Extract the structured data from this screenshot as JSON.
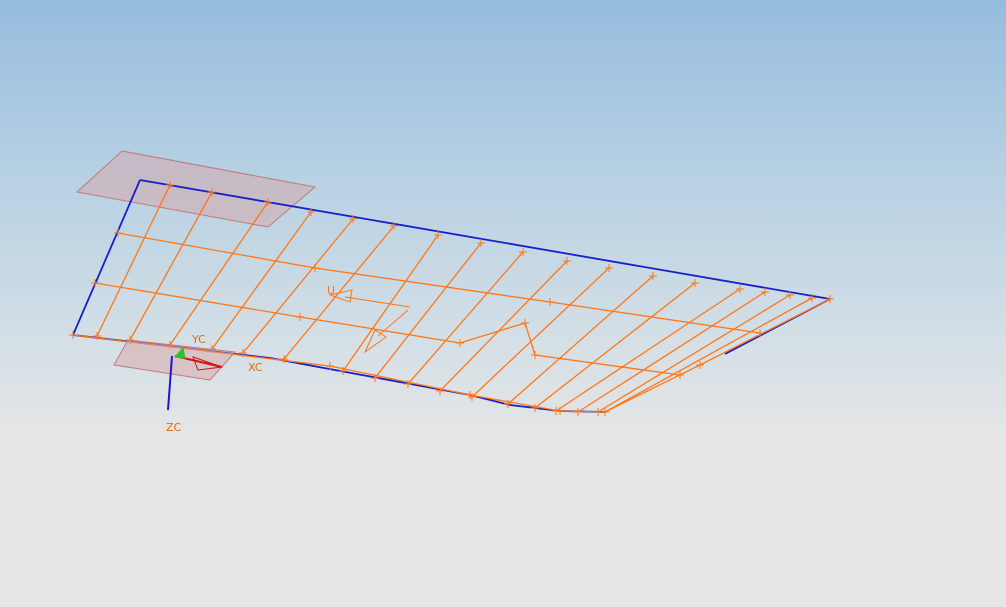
{
  "viewport": {
    "background_top": "#96bcdd",
    "background_bottom": "#e6e6e6"
  },
  "colors": {
    "grid_line": "#ff7716",
    "boundary": "#1420c8",
    "plane_fill": "#d9a0a0",
    "plane_stroke": "#c07a7a",
    "axis_x": "#d21414",
    "axis_y": "#2fbf2f",
    "axis_z": "#1a1acf",
    "axis_label": "#e06a10"
  },
  "triad": {
    "x_label": "XC",
    "y_label": "YC",
    "z_label": "ZC"
  }
}
